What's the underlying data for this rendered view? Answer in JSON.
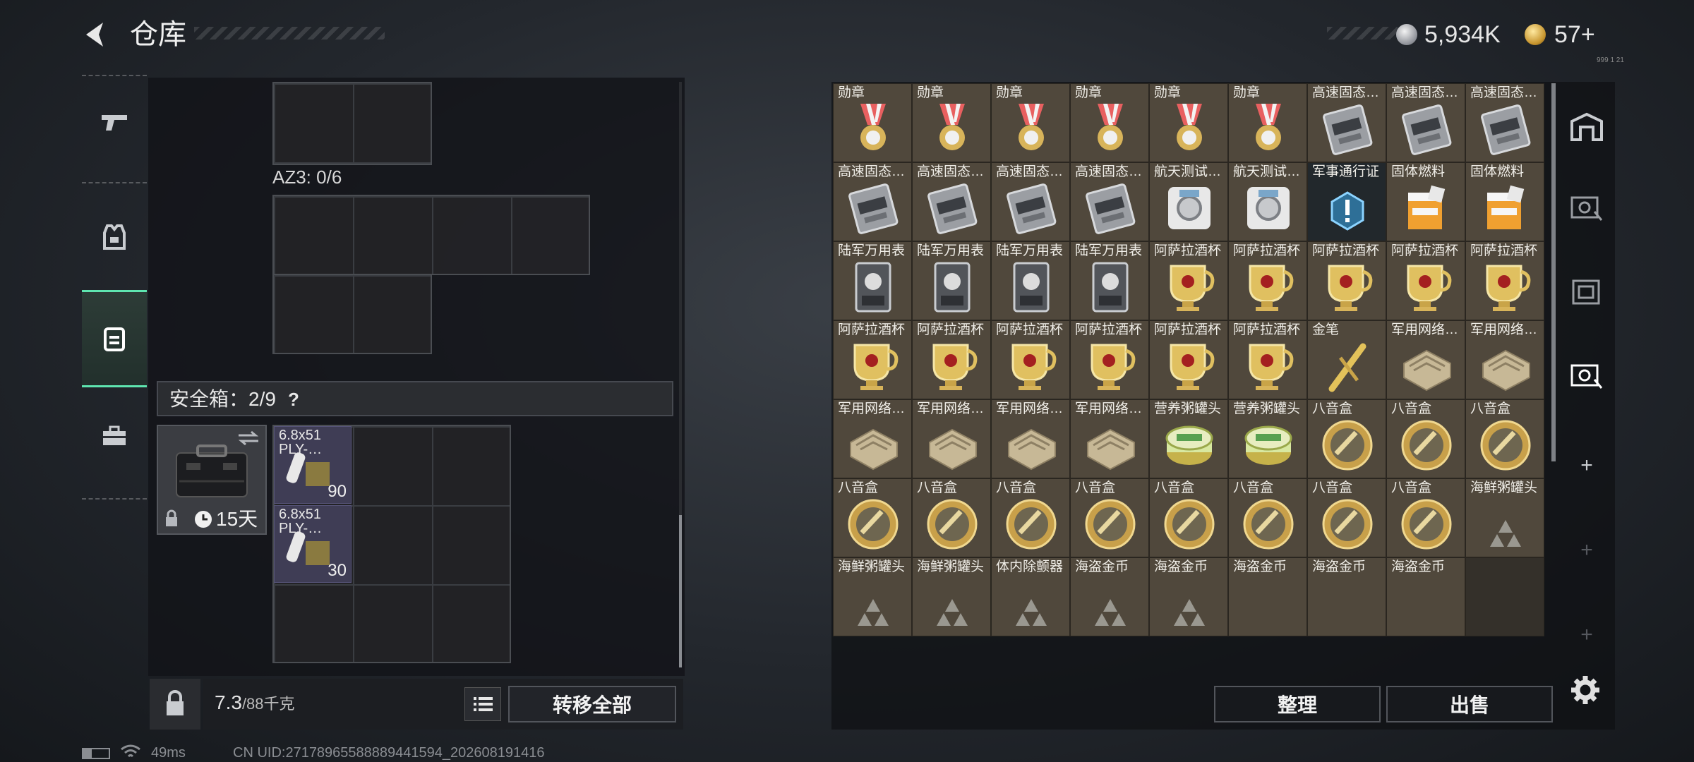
{
  "header": {
    "title": "仓库",
    "currency1": "5,934K",
    "currency2": "57+",
    "currency_small": "999 1 21"
  },
  "left": {
    "az3_label": "AZ3: 0/6",
    "safebox_label": "安全箱：2/9",
    "safebox_help": "?",
    "case_timer": "15天",
    "ammo": [
      {
        "name": "6.8x51 PLY-…",
        "count": "90"
      },
      {
        "name": "6.8x51 PLY-…",
        "count": "30"
      }
    ],
    "weight_value": "7.3",
    "weight_capacity": "/88千克",
    "transfer_all": "转移全部"
  },
  "status": {
    "ping": "49ms",
    "uid": "CN UID:27178965588889441594_202608191416"
  },
  "inventory": {
    "items": [
      {
        "label": "勋章",
        "icon": "medal"
      },
      {
        "label": "勋章",
        "icon": "medal"
      },
      {
        "label": "勋章",
        "icon": "medal"
      },
      {
        "label": "勋章",
        "icon": "medal"
      },
      {
        "label": "勋章",
        "icon": "medal"
      },
      {
        "label": "勋章",
        "icon": "medal"
      },
      {
        "label": "高速固态…",
        "icon": "ssd"
      },
      {
        "label": "高速固态…",
        "icon": "ssd"
      },
      {
        "label": "高速固态…",
        "icon": "ssd"
      },
      {
        "label": "高速固态…",
        "icon": "ssd"
      },
      {
        "label": "高速固态…",
        "icon": "ssd"
      },
      {
        "label": "高速固态…",
        "icon": "ssd"
      },
      {
        "label": "高速固态…",
        "icon": "ssd"
      },
      {
        "label": "航天测试…",
        "icon": "disk"
      },
      {
        "label": "航天测试…",
        "icon": "disk"
      },
      {
        "label": "军事通行证",
        "icon": "pass"
      },
      {
        "label": "固体燃料",
        "icon": "fuel"
      },
      {
        "label": "固体燃料",
        "icon": "fuel"
      },
      {
        "label": "陆军万用表",
        "icon": "multimeter"
      },
      {
        "label": "陆军万用表",
        "icon": "multimeter"
      },
      {
        "label": "陆军万用表",
        "icon": "multimeter"
      },
      {
        "label": "陆军万用表",
        "icon": "multimeter"
      },
      {
        "label": "阿萨拉酒杯",
        "icon": "goblet"
      },
      {
        "label": "阿萨拉酒杯",
        "icon": "goblet"
      },
      {
        "label": "阿萨拉酒杯",
        "icon": "goblet"
      },
      {
        "label": "阿萨拉酒杯",
        "icon": "goblet"
      },
      {
        "label": "阿萨拉酒杯",
        "icon": "goblet"
      },
      {
        "label": "阿萨拉酒杯",
        "icon": "goblet"
      },
      {
        "label": "阿萨拉酒杯",
        "icon": "goblet"
      },
      {
        "label": "阿萨拉酒杯",
        "icon": "goblet"
      },
      {
        "label": "阿萨拉酒杯",
        "icon": "goblet"
      },
      {
        "label": "阿萨拉酒杯",
        "icon": "goblet"
      },
      {
        "label": "阿萨拉酒杯",
        "icon": "goblet"
      },
      {
        "label": "金笔",
        "icon": "pen"
      },
      {
        "label": "军用网络…",
        "icon": "router"
      },
      {
        "label": "军用网络…",
        "icon": "router"
      },
      {
        "label": "军用网络…",
        "icon": "router"
      },
      {
        "label": "军用网络…",
        "icon": "router"
      },
      {
        "label": "军用网络…",
        "icon": "router"
      },
      {
        "label": "军用网络…",
        "icon": "router"
      },
      {
        "label": "营养粥罐头",
        "icon": "can"
      },
      {
        "label": "营养粥罐头",
        "icon": "can"
      },
      {
        "label": "八音盒",
        "icon": "musicbox"
      },
      {
        "label": "八音盒",
        "icon": "musicbox"
      },
      {
        "label": "八音盒",
        "icon": "musicbox"
      },
      {
        "label": "八音盒",
        "icon": "musicbox"
      },
      {
        "label": "八音盒",
        "icon": "musicbox"
      },
      {
        "label": "八音盒",
        "icon": "musicbox"
      },
      {
        "label": "八音盒",
        "icon": "musicbox"
      },
      {
        "label": "八音盒",
        "icon": "musicbox"
      },
      {
        "label": "八音盒",
        "icon": "musicbox"
      },
      {
        "label": "八音盒",
        "icon": "musicbox"
      },
      {
        "label": "八音盒",
        "icon": "musicbox"
      },
      {
        "label": "海鲜粥罐头",
        "icon": "unknown"
      },
      {
        "label": "海鲜粥罐头",
        "icon": "unknown"
      },
      {
        "label": "海鲜粥罐头",
        "icon": "unknown"
      },
      {
        "label": "体内除颤器",
        "icon": "unknown"
      },
      {
        "label": "海盗金币",
        "icon": "unknown"
      },
      {
        "label": "海盗金币",
        "icon": "unknown"
      },
      {
        "label": "海盗金币",
        "icon": "none"
      },
      {
        "label": "海盗金币",
        "icon": "none"
      },
      {
        "label": "海盗金币",
        "icon": "none"
      }
    ],
    "sort_button": "整理",
    "sell_button": "出售"
  },
  "colors": {
    "accent": "#5ee6b0",
    "item_bg": "#50483c",
    "pass_bg": "#22282c"
  }
}
